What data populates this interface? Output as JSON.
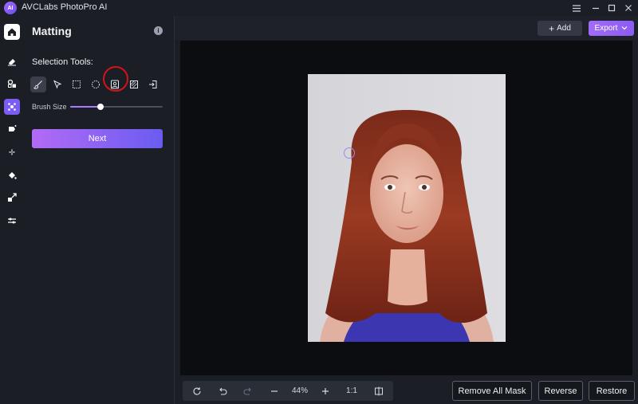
{
  "app": {
    "title": "AVCLabs PhotoPro AI",
    "logo_text": "AI"
  },
  "window_controls": [
    "menu-icon",
    "minimize-icon",
    "maximize-icon",
    "close-icon"
  ],
  "rail": {
    "items": [
      {
        "icon": "home-icon",
        "state": "home"
      },
      {
        "icon": "eraser-icon"
      },
      {
        "icon": "shapes-icon"
      },
      {
        "icon": "matting-icon",
        "state": "active"
      },
      {
        "icon": "enhance-icon"
      },
      {
        "icon": "fan-icon"
      },
      {
        "icon": "paint-bucket-icon"
      },
      {
        "icon": "resize-icon"
      },
      {
        "icon": "adjust-sliders-icon"
      }
    ]
  },
  "panel": {
    "title": "Matting",
    "section_label": "Selection Tools:",
    "tools": [
      {
        "icon": "brush-icon",
        "selected": true
      },
      {
        "icon": "pointer-icon"
      },
      {
        "icon": "rectangle-select-icon"
      },
      {
        "icon": "ellipse-select-icon"
      },
      {
        "icon": "portrait-select-icon",
        "highlighted": true
      },
      {
        "icon": "hatch-select-icon"
      },
      {
        "icon": "import-icon"
      }
    ],
    "brush_size_label": "Brush Size",
    "brush_size_fraction": 0.33,
    "next_label": "Next"
  },
  "topbar": {
    "add_label": "Add",
    "export_label": "Export"
  },
  "bottom": {
    "zoom": "44%",
    "ratio": "1:1",
    "remove_all_mask_label": "Remove All Mask",
    "reverse_label": "Reverse",
    "restore_label": "Restore"
  },
  "colors": {
    "accent": "#7b5cf5",
    "highlight_ring": "#d4131b",
    "background": "#1b1e25",
    "canvas": "#0b0d11"
  }
}
